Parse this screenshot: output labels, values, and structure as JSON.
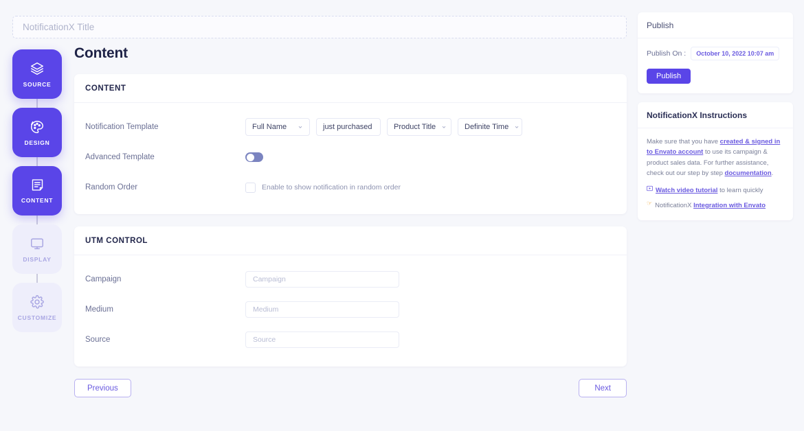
{
  "titleInput": {
    "value": "",
    "placeholder": "NotificationX Title"
  },
  "sidebar": {
    "items": [
      {
        "label": "SOURCE",
        "icon": "layers-icon",
        "state": "active"
      },
      {
        "label": "DESIGN",
        "icon": "palette-icon",
        "state": "active"
      },
      {
        "label": "CONTENT",
        "icon": "document-icon",
        "state": "active"
      },
      {
        "label": "DISPLAY",
        "icon": "monitor-icon",
        "state": "inactive"
      },
      {
        "label": "CUSTOMIZE",
        "icon": "gear-icon",
        "state": "inactive"
      }
    ]
  },
  "main": {
    "page_title": "Content",
    "content_card": {
      "heading": "CONTENT",
      "notification_template": {
        "label": "Notification Template",
        "name_select": "Full Name",
        "action_text": "just purchased",
        "product_select": "Product Title",
        "time_select": "Definite Time"
      },
      "advanced_template": {
        "label": "Advanced Template",
        "enabled": false
      },
      "random_order": {
        "label": "Random Order",
        "checkbox_text": "Enable to show notification in random order",
        "checked": false
      }
    },
    "utm_card": {
      "heading": "UTM CONTROL",
      "fields": [
        {
          "label": "Campaign",
          "value": "",
          "placeholder": "Campaign"
        },
        {
          "label": "Medium",
          "value": "",
          "placeholder": "Medium"
        },
        {
          "label": "Source",
          "value": "",
          "placeholder": "Source"
        }
      ]
    },
    "nav": {
      "previous": "Previous",
      "next": "Next"
    }
  },
  "right": {
    "publish_panel": {
      "heading": "Publish",
      "publish_on_label": "Publish On :",
      "publish_on_date": "October 10, 2022 10:07 am",
      "publish_button": "Publish"
    },
    "instructions_panel": {
      "heading": "NotificationX Instructions",
      "paragraph": {
        "part1": "Make sure that you have ",
        "link1": "created & signed in to Envato account",
        "part2": " to use its campaign & product sales data. For further assistance, check out our step by step ",
        "link2": "documentation",
        "part3": "."
      },
      "video_line": {
        "icon": "video-icon",
        "link": "Watch video tutorial",
        "text": " to learn quickly"
      },
      "integration_line": {
        "icon": "pointing-hand-icon",
        "text": "NotificationX ",
        "link": "Integration with Envato"
      }
    }
  },
  "colors": {
    "accent": "#5a45e8",
    "link": "#6a5ae0",
    "background": "#f6f7fb",
    "card": "#ffffff",
    "inactive_step": "#eeeefb"
  }
}
